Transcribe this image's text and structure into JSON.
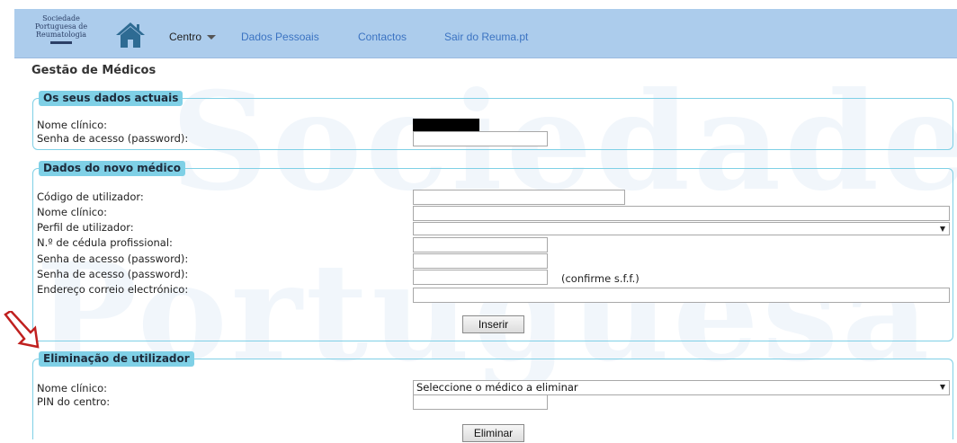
{
  "watermark": {
    "line1": "Sociedade",
    "line2": "Portuguesa de"
  },
  "logo": {
    "line1": "Sociedade",
    "line2": "Portuguesa de",
    "line3": "Reumatologia"
  },
  "nav": {
    "centro": "Centro",
    "dados_pessoais": "Dados Pessoais",
    "contactos": "Contactos",
    "sair": "Sair do Reuma.pt"
  },
  "page_title": "Gestão de Médicos",
  "current": {
    "legend": "Os seus dados actuais",
    "nome_label": "Nome clínico:",
    "senha_label": "Senha de acesso (password):",
    "senha_value": ""
  },
  "novo": {
    "legend": "Dados do novo médico",
    "codigo_label": "Código de utilizador:",
    "nome_label": "Nome clínico:",
    "perfil_label": "Perfil de utilizador:",
    "cedula_label": "N.º de cédula profissional:",
    "senha_label": "Senha de acesso (password):",
    "senha2_label": "Senha de acesso (password):",
    "confirm_hint": "(confirme s.f.f.)",
    "email_label": "Endereço correio electrónico:",
    "codigo_value": "",
    "nome_value": "",
    "perfil_value": "",
    "cedula_value": "",
    "senha_value": "",
    "senha2_value": "",
    "email_value": "",
    "submit": "Inserir"
  },
  "eliminar": {
    "legend": "Eliminação de utilizador",
    "nome_label": "Nome clínico:",
    "pin_label": "PIN do centro:",
    "select_value": "Seleccione o médico a eliminar",
    "pin_value": "",
    "submit": "Eliminar"
  },
  "colors": {
    "nav_bg": "#acccec",
    "panel_border": "#7fd0e6",
    "link": "#3b73c2",
    "arrow": "#c0201f"
  },
  "icons": {
    "home": "home-icon",
    "caret": "caret-down-icon",
    "arrow": "red-arrow-icon"
  }
}
